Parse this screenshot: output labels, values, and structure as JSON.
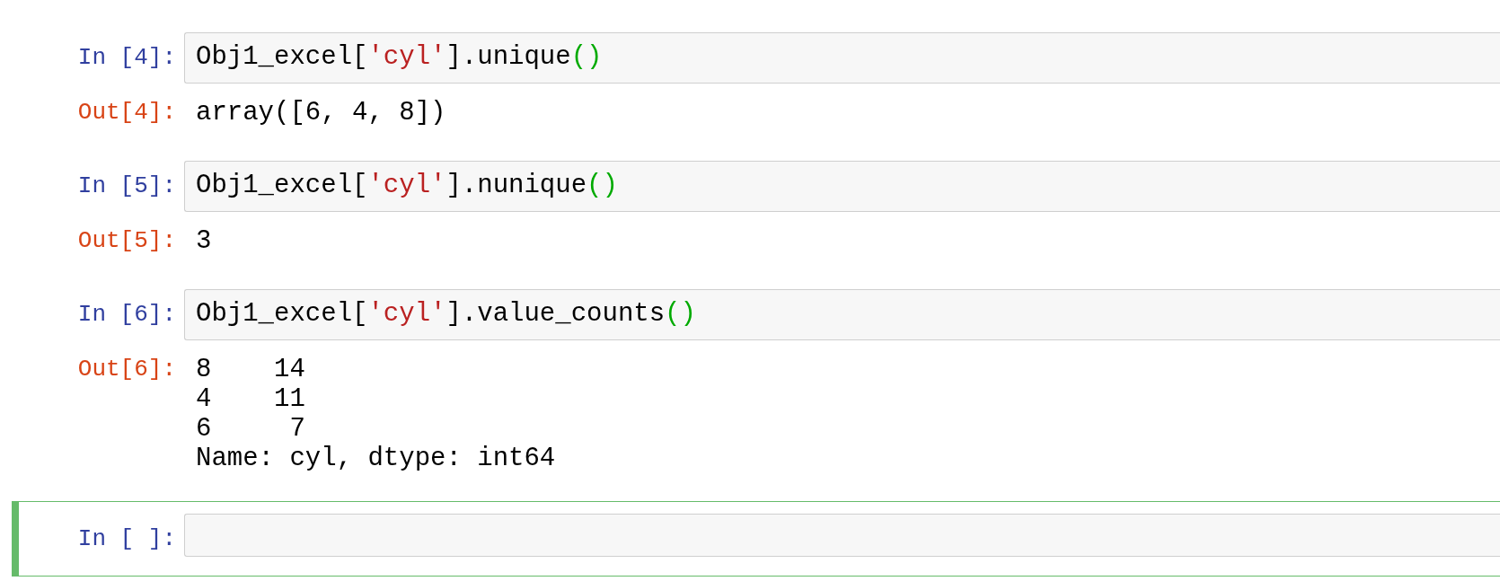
{
  "cells": [
    {
      "prompt": "In [4]:",
      "selected": false,
      "code": [
        {
          "kind": "name",
          "text": "Obj1_excel["
        },
        {
          "kind": "string",
          "text": "'cyl'"
        },
        {
          "kind": "name",
          "text": "].unique"
        },
        {
          "kind": "paren",
          "text": "()"
        }
      ],
      "output_prompt": "Out[4]:",
      "output": [
        "array([6, 4, 8])"
      ]
    },
    {
      "prompt": "In [5]:",
      "selected": false,
      "code": [
        {
          "kind": "name",
          "text": "Obj1_excel["
        },
        {
          "kind": "string",
          "text": "'cyl'"
        },
        {
          "kind": "name",
          "text": "].nunique"
        },
        {
          "kind": "paren",
          "text": "()"
        }
      ],
      "output_prompt": "Out[5]:",
      "output": [
        "3"
      ]
    },
    {
      "prompt": "In [6]:",
      "selected": false,
      "code": [
        {
          "kind": "name",
          "text": "Obj1_excel["
        },
        {
          "kind": "string",
          "text": "'cyl'"
        },
        {
          "kind": "name",
          "text": "].value_counts"
        },
        {
          "kind": "paren",
          "text": "()"
        }
      ],
      "output_prompt": "Out[6]:",
      "output": [
        "8    14",
        "4    11",
        "6     7",
        "Name: cyl, dtype: int64"
      ]
    },
    {
      "prompt": "In [ ]:",
      "selected": true
    }
  ]
}
